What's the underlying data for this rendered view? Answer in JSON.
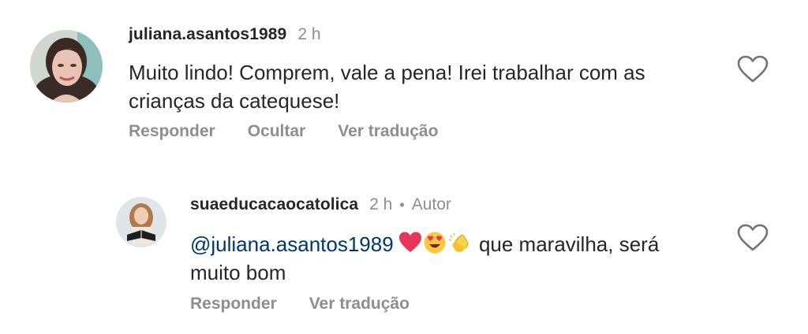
{
  "comments": [
    {
      "username": "juliana.asantos1989",
      "time": "2 h",
      "text": "Muito lindo! Comprem, vale a pena! Irei trabalhar com as crianças da catequese!",
      "actions": {
        "reply": "Responder",
        "hide": "Ocultar",
        "translate": "Ver tradução"
      },
      "avatar_icon": "woman-glasses-avatar",
      "like_icon": "heart-outline-icon"
    },
    {
      "username": "suaeducacaocatolica",
      "time": "2 h",
      "separator": "•",
      "badge": "Autor",
      "mention": "@juliana.asantos1989",
      "emojis": [
        "red-heart",
        "heart-eyes-face",
        "clapping-hands"
      ],
      "text": "que maravilha, será muito bom",
      "actions": {
        "reply": "Responder",
        "translate": "Ver tradução"
      },
      "avatar_icon": "woman-reading-avatar",
      "like_icon": "heart-outline-icon"
    }
  ],
  "colors": {
    "text": "#262626",
    "secondary": "#8e8e8e",
    "mention": "#00376b",
    "background": "#ffffff"
  }
}
